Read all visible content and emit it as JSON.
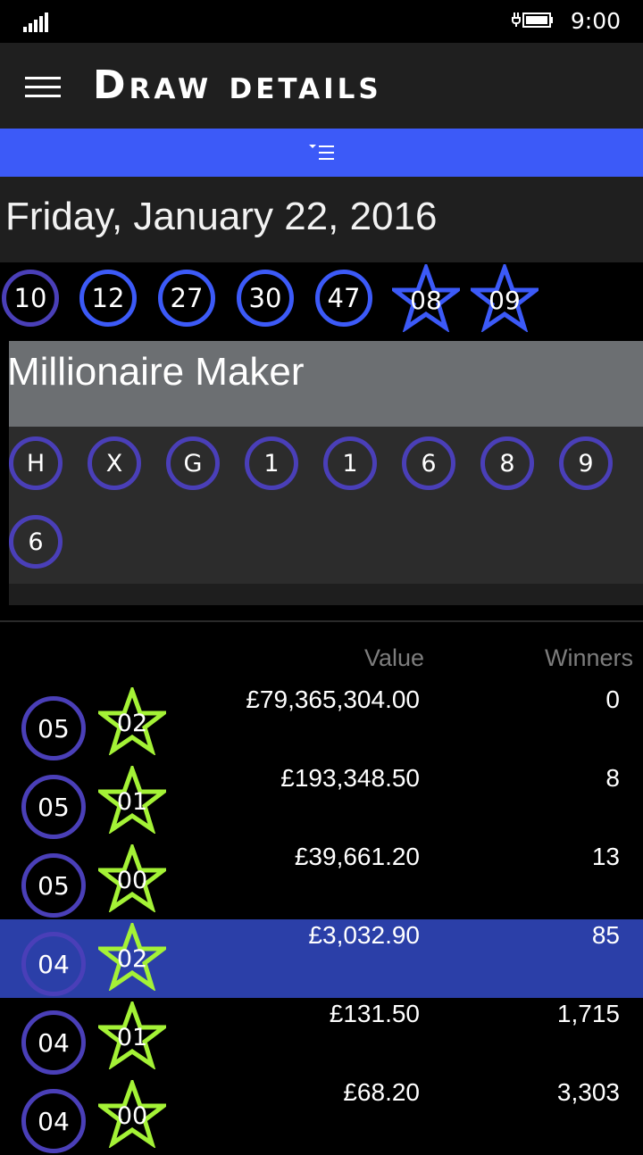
{
  "status": {
    "time": "9:00"
  },
  "header": {
    "title": "Draw details"
  },
  "draw": {
    "date": "Friday, January 22, 2016",
    "balls": [
      "10",
      "12",
      "27",
      "30",
      "47"
    ],
    "stars": [
      "08",
      "09"
    ]
  },
  "millionaire": {
    "title": "Millionaire Maker",
    "code": [
      "H",
      "X",
      "G",
      "1",
      "1",
      "6",
      "8",
      "9",
      "6"
    ]
  },
  "prizes": {
    "value_header": "Value",
    "winners_header": "Winners",
    "rows": [
      {
        "balls": "05",
        "stars": "02",
        "value": "£79,365,304.00",
        "winners": "0",
        "selected": false
      },
      {
        "balls": "05",
        "stars": "01",
        "value": "£193,348.50",
        "winners": "8",
        "selected": false
      },
      {
        "balls": "05",
        "stars": "00",
        "value": "£39,661.20",
        "winners": "13",
        "selected": false
      },
      {
        "balls": "04",
        "stars": "02",
        "value": "£3,032.90",
        "winners": "85",
        "selected": true
      },
      {
        "balls": "04",
        "stars": "01",
        "value": "£131.50",
        "winners": "1,715",
        "selected": false
      },
      {
        "balls": "04",
        "stars": "00",
        "value": "£68.20",
        "winners": "3,303",
        "selected": false
      }
    ]
  },
  "colors": {
    "accent": "#3c5af8",
    "ball_border_dark": "#4a3fb8",
    "prize_star": "#a4f236",
    "selected_row": "#2b3fa8"
  },
  "icons": [
    "signal-icon",
    "battery-charging-icon",
    "hamburger-menu-icon",
    "filter-list-icon",
    "star-icon"
  ]
}
